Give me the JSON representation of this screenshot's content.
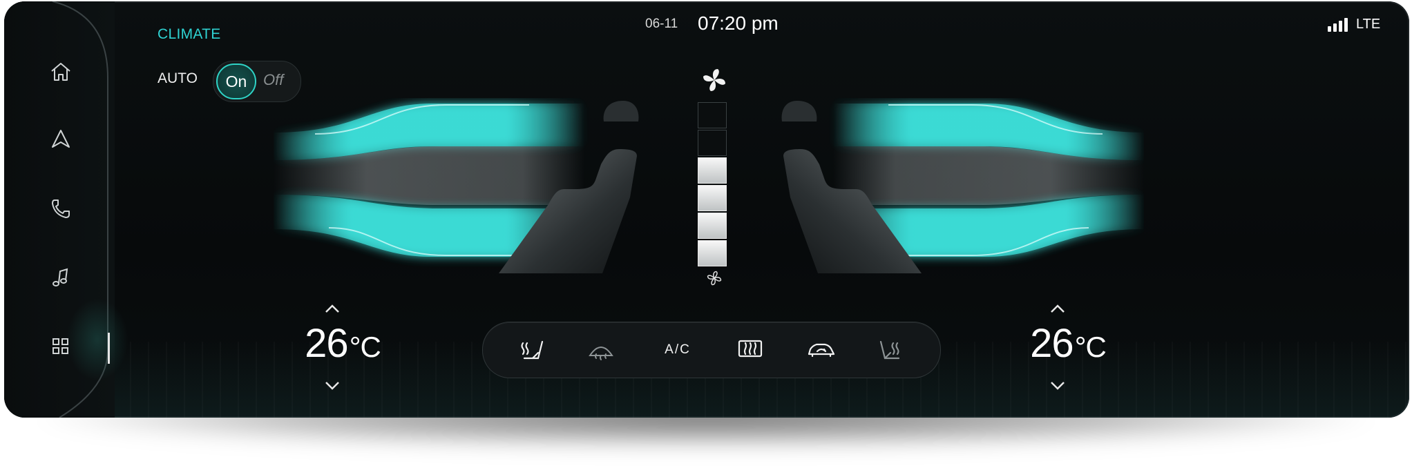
{
  "header": {
    "title": "CLIMATE",
    "date": "06-11",
    "time": "07:20 pm",
    "network": "LTE",
    "signal_bars": 4
  },
  "auto": {
    "label": "AUTO",
    "on_label": "On",
    "off_label": "Off",
    "selected": "On"
  },
  "sidebar": {
    "items": [
      {
        "icon": "home-icon"
      },
      {
        "icon": "navigation-icon"
      },
      {
        "icon": "phone-icon"
      },
      {
        "icon": "music-note-icon"
      },
      {
        "icon": "apps-grid-icon",
        "active": true
      }
    ]
  },
  "fan": {
    "level": 4,
    "max_level": 6
  },
  "temperature": {
    "left": {
      "value": "26",
      "unit": "°C"
    },
    "right": {
      "value": "26",
      "unit": "°C"
    }
  },
  "controls": {
    "items": [
      {
        "icon": "seat-heat-left-icon",
        "active": true
      },
      {
        "icon": "front-defrost-icon",
        "active": false
      },
      {
        "icon": "ac-button",
        "label": "A/C",
        "active": true
      },
      {
        "icon": "rear-defrost-icon",
        "active": true
      },
      {
        "icon": "recirculation-icon",
        "active": true
      },
      {
        "icon": "seat-heat-right-icon",
        "active": false
      }
    ]
  },
  "colors": {
    "accent": "#2fd3d3",
    "background": "#080b0c",
    "airflow": "#3ee6e0"
  }
}
